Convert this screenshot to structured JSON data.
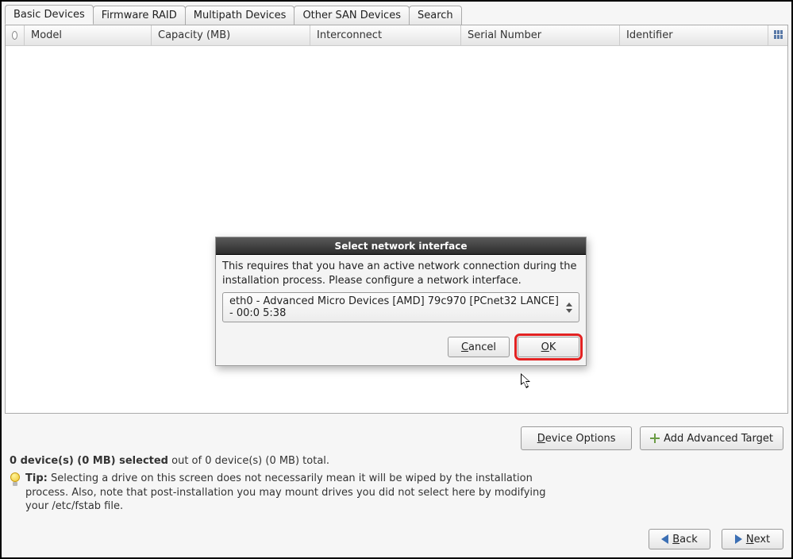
{
  "tabs": {
    "basic": "Basic Devices",
    "firmware": "Firmware RAID",
    "multipath": "Multipath Devices",
    "other_san": "Other SAN Devices",
    "search": "Search"
  },
  "columns": {
    "model": "Model",
    "capacity": "Capacity (MB)",
    "interconnect": "Interconnect",
    "serial": "Serial Number",
    "identifier": "Identifier"
  },
  "dialog": {
    "title": "Select network interface",
    "body": "This requires that you have an active network connection during the installation process.  Please configure a network interface.",
    "combo": "eth0 - Advanced Micro Devices [AMD] 79c970 [PCnet32 LANCE] - 00:0 5:38",
    "cancel": "Cancel",
    "ok": "OK"
  },
  "buttons": {
    "device_options": "Device Options",
    "device_options_hot": "D",
    "add_advanced_target": "Add Advanced Target",
    "back": "Back",
    "back_hot": "B",
    "next": "Next",
    "next_hot": "N"
  },
  "summary": {
    "bold": "0 device(s) (0 MB) selected",
    "rest": " out of 0 device(s) (0 MB) total."
  },
  "tip": {
    "label": "Tip:",
    "text": " Selecting a drive on this screen does not necessarily mean it will be wiped by the installation process.  Also, note that post-installation you may mount drives you did not select here by modifying your /etc/fstab file."
  }
}
